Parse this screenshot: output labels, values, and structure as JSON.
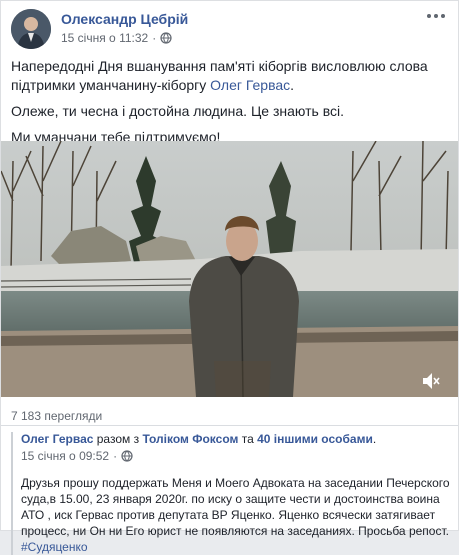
{
  "post": {
    "author": "Олександр Цебрій",
    "date": "15 січня о 11:32",
    "privacy_icon": "globe-icon",
    "more_icon": "more-dots-icon",
    "paragraph1_prefix": "Напередодні Дня вшанування пам'яті кіборгів висловлюю слова підтримки уманчанину-кіборгу ",
    "paragraph1_link": "Олег Гервас",
    "paragraph1_suffix": ".",
    "paragraph2": "Олеже, ти чесна і достойна людина. Це знають всі.",
    "paragraph3": "Ми уманчани тебе підтримуємо!"
  },
  "video": {
    "volume_icon": "speaker-mute-icon"
  },
  "views": "7 183 перегляди",
  "shared": {
    "author": "Олег Гервас",
    "with_text": " разом з ",
    "tagged1": "Толіком Фоксом",
    "and_text": " та ",
    "tagged2": "40 іншими особами",
    "tail": ".",
    "date": "15 січня о 09:52",
    "text": "Друзья прошу поддержать Меня и Моего Адвоката на заседании Печерского суда,в 15.00, 23 января 2020г. по иску о защите чести и достоинства воина АТО , иск Гервас против депутата ВР Яценко. Яценко всячески затягивает процесс, ни Он ни Его юрист не появляются на заседаниях. Просьба репост. ",
    "hashtag": "#Судяценко"
  },
  "colors": {
    "link": "#385898",
    "meta": "#616770"
  }
}
